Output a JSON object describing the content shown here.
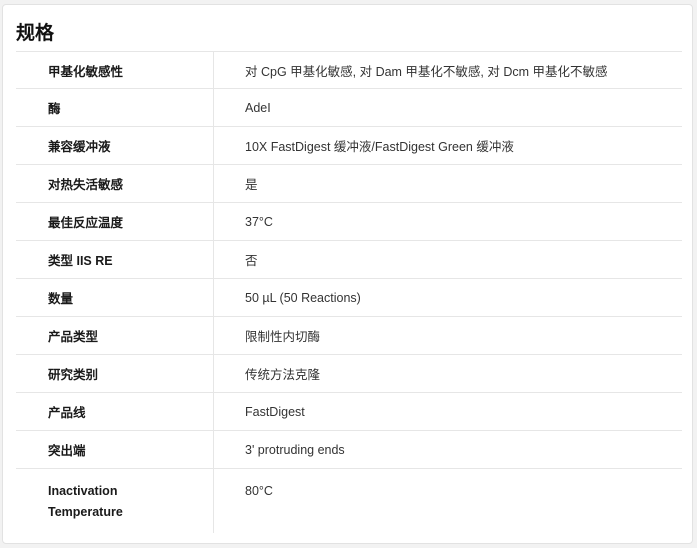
{
  "section": {
    "title": "规格"
  },
  "specs": [
    {
      "label": "甲基化敏感性",
      "value": "对 CpG 甲基化敏感, 对 Dam 甲基化不敏感, 对 Dcm 甲基化不敏感"
    },
    {
      "label": "酶",
      "value": "AdeI"
    },
    {
      "label": "兼容缓冲液",
      "value": "10X FastDigest 缓冲液/FastDigest Green 缓冲液"
    },
    {
      "label": "对热失活敏感",
      "value": "是"
    },
    {
      "label": "最佳反应温度",
      "value": "37°C"
    },
    {
      "label": "类型 IIS RE",
      "value": "否"
    },
    {
      "label": "数量",
      "value": "50 µL (50 Reactions)"
    },
    {
      "label": "产品类型",
      "value": "限制性内切酶"
    },
    {
      "label": "研究类别",
      "value": "传统方法克隆"
    },
    {
      "label": "产品线",
      "value": "FastDigest"
    },
    {
      "label": "突出端",
      "value": "3' protruding ends"
    },
    {
      "label_line1": "Inactivation",
      "label_line2": "Temperature",
      "value": "80°C"
    }
  ]
}
